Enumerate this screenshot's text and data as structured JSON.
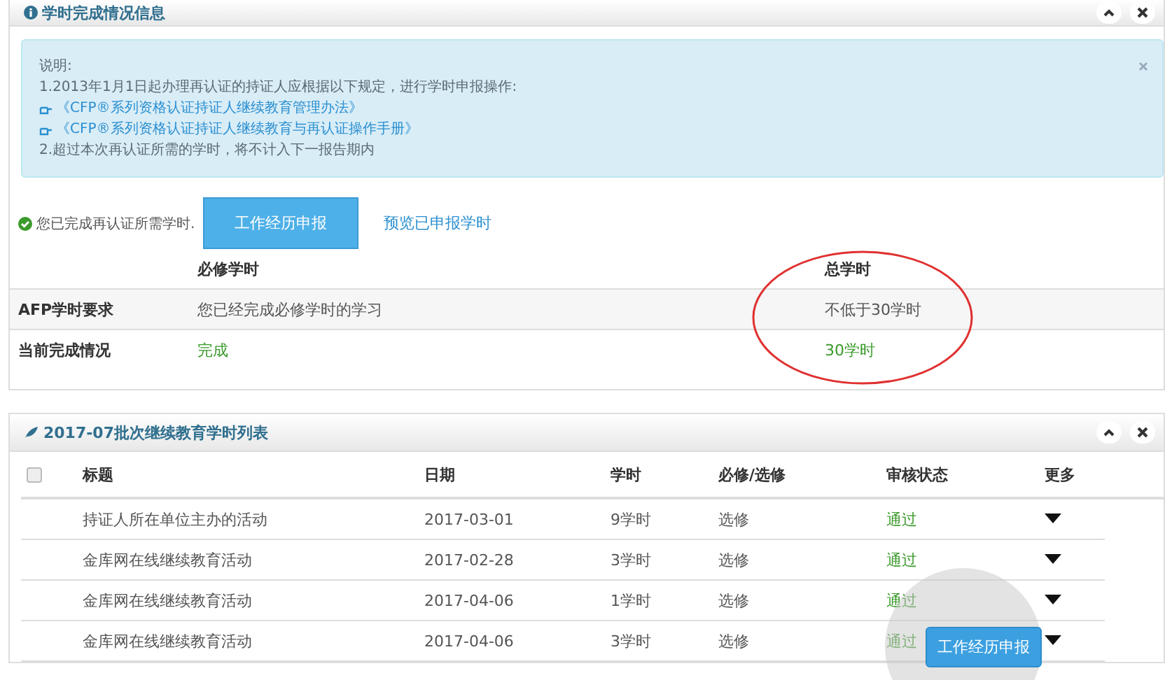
{
  "panel1": {
    "title": "学时完成情况信息",
    "alert": {
      "lines": [
        {
          "kind": "text",
          "text": "说明:"
        },
        {
          "kind": "text",
          "text": "1.2013年1月1日起办理再认证的持证人应根据以下规定，进行学时申报操作:"
        },
        {
          "kind": "link",
          "text": "《CFP®系列资格认证持证人继续教育管理办法》"
        },
        {
          "kind": "link",
          "text": "《CFP®系列资格认证持证人继续教育与再认证操作手册》"
        },
        {
          "kind": "text",
          "text": "2.超过本次再认证所需的学时，将不计入下一报告期内"
        }
      ]
    },
    "status": "您已完成再认证所需学时.",
    "apply_button": "工作经历申报",
    "preview_link": "预览已申报学时",
    "summary": {
      "columns": [
        "必修学时",
        "总学时"
      ],
      "rows": [
        {
          "label": "AFP学时要求",
          "required": "您已经完成必修学时的学习",
          "total": "不低于30学时",
          "highlight": false
        },
        {
          "label": "当前完成情况",
          "required": "完成",
          "total": "30学时",
          "highlight": true
        }
      ]
    }
  },
  "panel2": {
    "title": "2017-07批次继续教育学时列表",
    "select_all": false,
    "columns": [
      "标题",
      "日期",
      "学时",
      "必修/选修",
      "审核状态",
      "更多"
    ],
    "rows": [
      {
        "title": "持证人所在单位主办的活动",
        "date": "2017-03-01",
        "hours": "9学时",
        "type": "选修",
        "status": "通过"
      },
      {
        "title": "金库网在线继续教育活动",
        "date": "2017-02-28",
        "hours": "3学时",
        "type": "选修",
        "status": "通过"
      },
      {
        "title": "金库网在线继续教育活动",
        "date": "2017-04-06",
        "hours": "1学时",
        "type": "选修",
        "status": "通过"
      },
      {
        "title": "金库网在线继续教育活动",
        "date": "2017-04-06",
        "hours": "3学时",
        "type": "选修",
        "status": "通过"
      }
    ],
    "floating_button": "工作经历申报"
  }
}
